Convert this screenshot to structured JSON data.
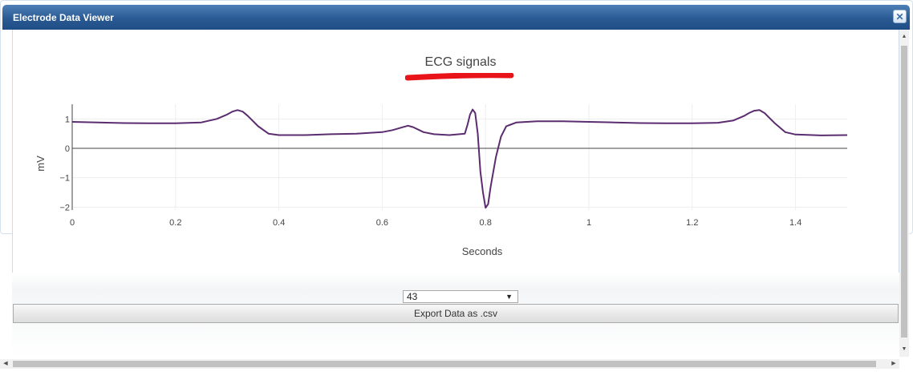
{
  "window": {
    "title": "Electrode Data Viewer",
    "close_icon": "close-icon"
  },
  "chart_data": {
    "type": "line",
    "title": "ECG signals",
    "xlabel": "Seconds",
    "ylabel": "mV",
    "xlim": [
      0,
      1.5
    ],
    "ylim": [
      -2.1,
      1.5
    ],
    "x_ticks": [
      "0",
      "0.2",
      "0.4",
      "0.6",
      "0.8",
      "1",
      "1.2",
      "1.4"
    ],
    "y_ticks": [
      "1",
      "0",
      "−1",
      "−2"
    ],
    "grid": true,
    "zero_line": true,
    "line_color": "#5b2c6f",
    "series": [
      {
        "x": [
          0,
          0.05,
          0.1,
          0.15,
          0.2,
          0.25,
          0.28,
          0.3,
          0.31,
          0.32,
          0.33,
          0.34,
          0.36,
          0.38,
          0.4,
          0.45,
          0.5,
          0.55,
          0.6,
          0.62,
          0.64,
          0.65,
          0.66,
          0.68,
          0.7,
          0.73,
          0.76,
          0.765,
          0.77,
          0.775,
          0.78,
          0.785,
          0.79,
          0.795,
          0.8,
          0.805,
          0.81,
          0.82,
          0.83,
          0.84,
          0.86,
          0.88,
          0.9,
          0.95,
          1.0,
          1.05,
          1.1,
          1.15,
          1.2,
          1.25,
          1.28,
          1.3,
          1.31,
          1.32,
          1.33,
          1.34,
          1.36,
          1.38,
          1.4,
          1.45,
          1.5
        ],
        "y": [
          0.9,
          0.88,
          0.86,
          0.85,
          0.85,
          0.88,
          1.0,
          1.15,
          1.25,
          1.3,
          1.25,
          1.1,
          0.75,
          0.5,
          0.45,
          0.45,
          0.48,
          0.5,
          0.55,
          0.62,
          0.72,
          0.77,
          0.72,
          0.55,
          0.48,
          0.45,
          0.5,
          0.8,
          1.15,
          1.32,
          1.2,
          0.5,
          -0.8,
          -1.5,
          -2.02,
          -1.9,
          -1.3,
          -0.3,
          0.4,
          0.75,
          0.88,
          0.9,
          0.92,
          0.92,
          0.9,
          0.88,
          0.86,
          0.85,
          0.85,
          0.87,
          0.95,
          1.1,
          1.2,
          1.28,
          1.3,
          1.2,
          0.85,
          0.55,
          0.47,
          0.44,
          0.45
        ]
      }
    ]
  },
  "channel_select": {
    "value": "43",
    "arrow_icon": "dropdown-arrow-icon"
  },
  "export_button": {
    "label": "Export Data as .csv"
  },
  "scroll": {
    "up_glyph": "▲",
    "down_glyph": "▼",
    "left_glyph": "◀",
    "right_glyph": "▶"
  }
}
